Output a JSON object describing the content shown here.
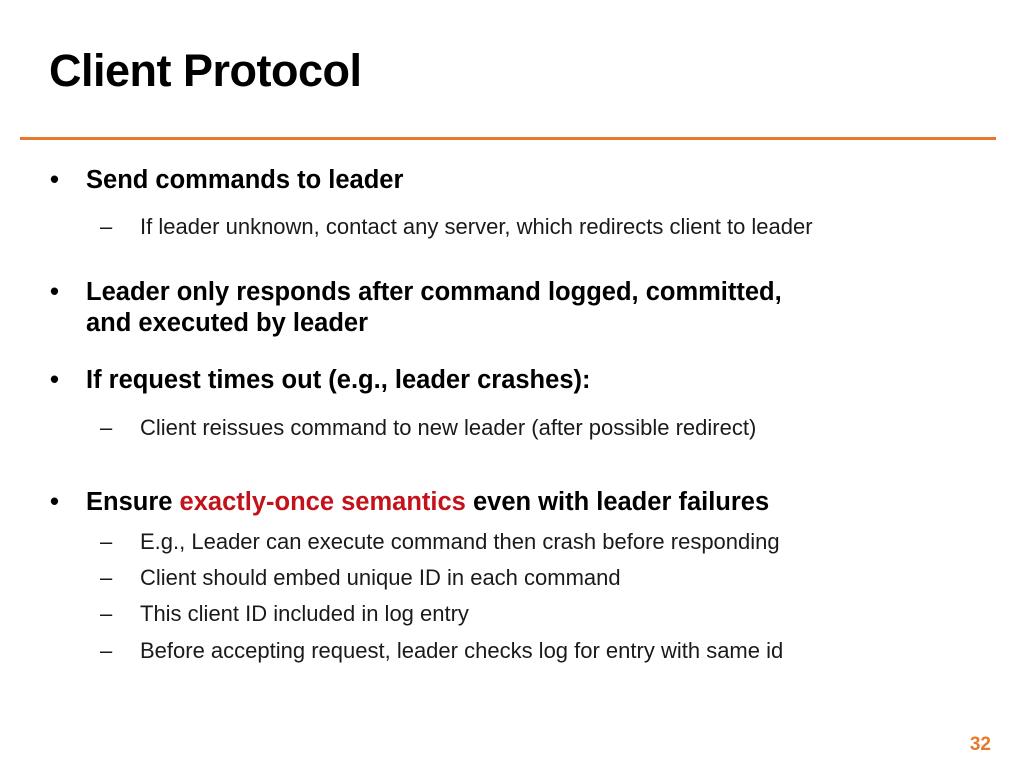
{
  "slide": {
    "title": "Client Protocol",
    "page_number": "32",
    "accent_color": "#E8792A",
    "highlight_color": "#C3121A",
    "bullet_marker": "•",
    "sub_bullet_marker": "–",
    "bullets": [
      {
        "level": 1,
        "text": "Send commands to leader"
      },
      {
        "level": 2,
        "text": "If leader unknown, contact any server, which redirects client to leader"
      },
      {
        "level": 1,
        "text": "Leader only responds after command logged, committed, and executed by leader"
      },
      {
        "level": 1,
        "text": "If request times out (e.g., leader crashes):"
      },
      {
        "level": 2,
        "text": "Client reissues command to new leader (after possible redirect)"
      },
      {
        "level": 1,
        "text_before": "Ensure ",
        "highlight": "exactly-once semantics",
        "text_after": " even with leader failures"
      },
      {
        "level": 2,
        "text": "E.g., Leader can execute command then crash before responding"
      },
      {
        "level": 2,
        "text": "Client should embed unique ID in each command"
      },
      {
        "level": 2,
        "text": "This client ID included in log entry"
      },
      {
        "level": 2,
        "text": "Before accepting request, leader checks log for entry with same id"
      }
    ]
  }
}
